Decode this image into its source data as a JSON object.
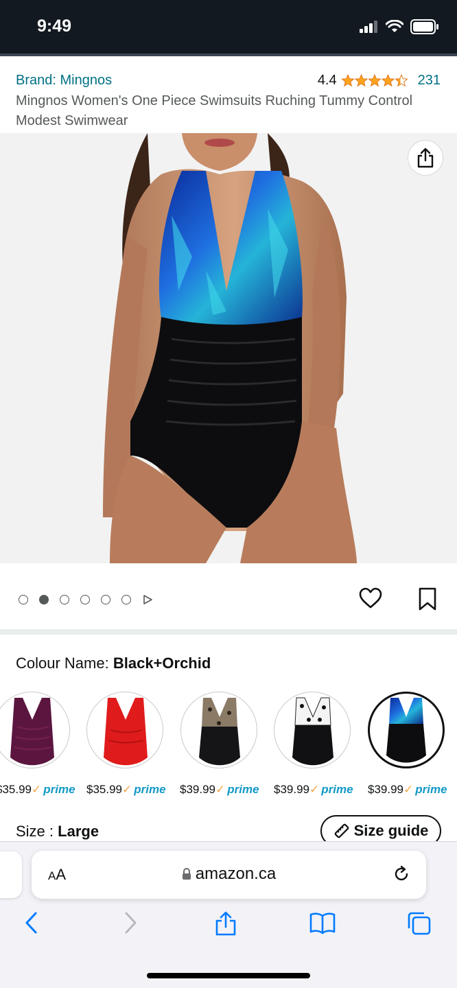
{
  "status_bar": {
    "time": "9:49"
  },
  "product": {
    "brand": "Brand: Mingnos",
    "rating": "4.4",
    "stars_value": 4.4,
    "review_count": "231",
    "title": "Mingnos Women's One Piece Swimsuits Ruching Tummy Control Modest Swimwear"
  },
  "gallery": {
    "image_count": 6,
    "active_index": 1,
    "has_video": true
  },
  "colour": {
    "label": "Colour Name: ",
    "value": "Black+Orchid",
    "options": [
      {
        "name": "Purple",
        "price": "$35.99",
        "prime": "prime"
      },
      {
        "name": "Red",
        "price": "$35.99",
        "prime": "prime"
      },
      {
        "name": "Leopard",
        "price": "$39.99",
        "prime": "prime"
      },
      {
        "name": "Polka Dot",
        "price": "$39.99",
        "prime": "prime"
      },
      {
        "name": "Black+Orchid",
        "price": "$39.99",
        "prime": "prime"
      }
    ]
  },
  "size": {
    "label": "Size : ",
    "value": "Large",
    "guide_label": "Size guide"
  },
  "browser": {
    "aa_label": "AA",
    "url": "amazon.ca"
  },
  "colors": {
    "link": "#007185",
    "star": "#ffa41c",
    "prime": "#1399c6",
    "ios_blue": "#007aff",
    "header_bg": "#131921"
  }
}
